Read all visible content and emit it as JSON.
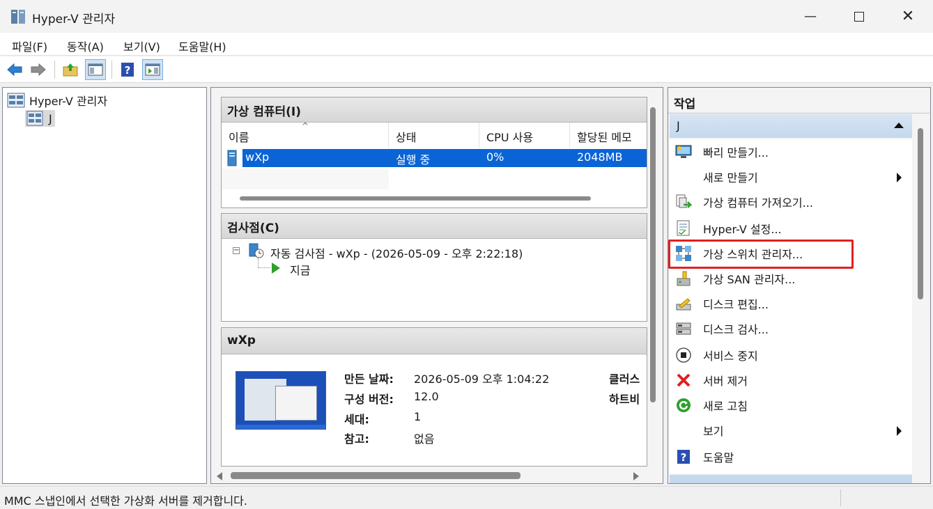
{
  "window": {
    "title": "Hyper-V 관리자"
  },
  "menu": [
    "파일(F)",
    "동작(A)",
    "보기(V)",
    "도움말(H)"
  ],
  "tree": {
    "root": "Hyper-V 관리자",
    "child": "J"
  },
  "vm_section": {
    "title": "가상 컴퓨터(I)",
    "columns": [
      "이름",
      "상태",
      "CPU 사용",
      "할당된 메모"
    ],
    "rows": [
      {
        "name": "wXp",
        "state": "실행 중",
        "cpu": "0%",
        "memory": "2048MB"
      }
    ]
  },
  "checkpoint_section": {
    "title": "검사점(C)",
    "checkpoint": "자동 검사점 - wXp - (2026-05-09 - 오후 2:22:18)",
    "now": "지금"
  },
  "details_section": {
    "title": "wXp",
    "fields": [
      {
        "label": "만든 날짜:",
        "value": "2026-05-09 오후 1:04:22"
      },
      {
        "label": "구성 버전:",
        "value": "12.0"
      },
      {
        "label": "세대:",
        "value": "1"
      },
      {
        "label": "참고:",
        "value": "없음"
      }
    ],
    "right_labels": [
      "클러스",
      "하트비"
    ]
  },
  "actions": {
    "header": "작업",
    "group": "J",
    "items": [
      {
        "label": "빠리 만들기...",
        "icon": "quick-create-icon"
      },
      {
        "label": "새로 만들기",
        "icon": "none",
        "submenu": true
      },
      {
        "label": "가상 컴퓨터 가져오기...",
        "icon": "import-vm-icon"
      },
      {
        "label": "Hyper-V 설정...",
        "icon": "settings-doc-icon"
      },
      {
        "label": "가상 스위치 관리자...",
        "icon": "virtual-switch-icon"
      },
      {
        "label": "가상 SAN 관리자...",
        "icon": "san-icon"
      },
      {
        "label": "디스크 편집...",
        "icon": "edit-disk-icon"
      },
      {
        "label": "디스크 검사...",
        "icon": "inspect-disk-icon"
      },
      {
        "label": "서비스 중지",
        "icon": "stop-service-icon"
      },
      {
        "label": "서버 제거",
        "icon": "remove-server-icon"
      },
      {
        "label": "새로 고침",
        "icon": "refresh-icon"
      },
      {
        "label": "보기",
        "icon": "none",
        "submenu": true
      },
      {
        "label": "도움말",
        "icon": "help-icon"
      }
    ]
  },
  "status": {
    "text": "MMC 스냅인에서 선택한 가상화 서버를 제거합니다."
  },
  "colors": {
    "selection": "#0a64d6",
    "highlight_box": "#e02020",
    "group_header": "#c4d8ee"
  }
}
